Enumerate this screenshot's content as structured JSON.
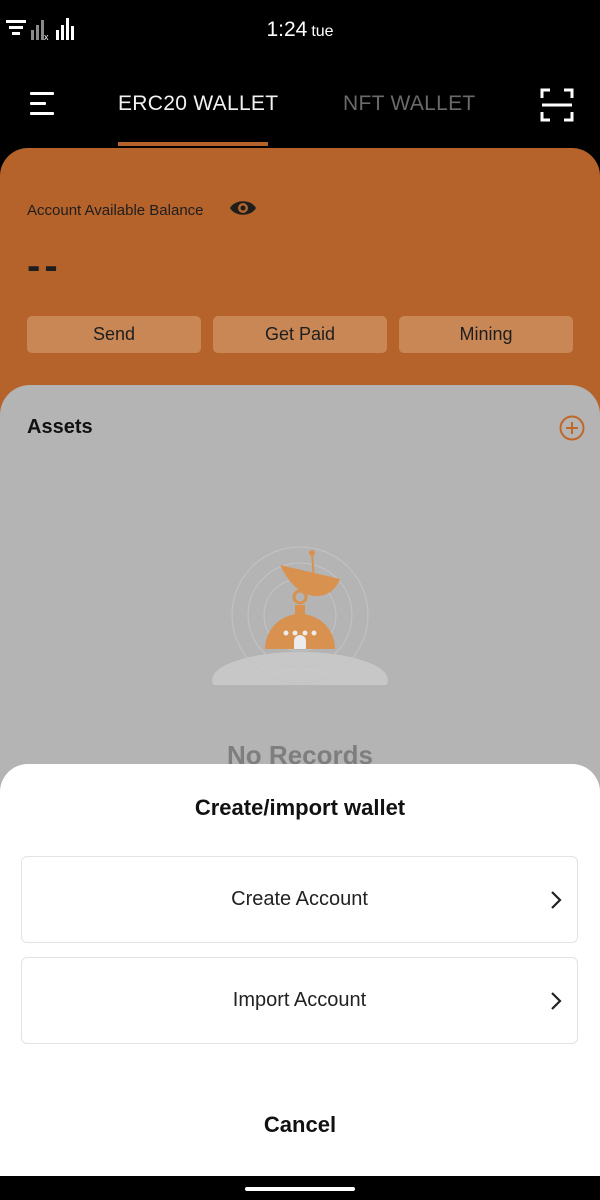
{
  "status_bar": {
    "time": "1:24",
    "day": "tue"
  },
  "nav": {
    "tabs": [
      {
        "label": "ERC20 WALLET",
        "active": true
      },
      {
        "label": "NFT WALLET",
        "active": false
      }
    ],
    "icons": [
      "menu-icon",
      "scan-icon"
    ]
  },
  "balance": {
    "label": "Account Available Balance",
    "value": "--",
    "actions": [
      "Send",
      "Get Paid",
      "Mining"
    ]
  },
  "assets": {
    "title": "Assets",
    "empty_text": "No Records"
  },
  "sheet": {
    "title": "Create/import wallet",
    "options": [
      "Create Account",
      "Import Account"
    ],
    "cancel_label": "Cancel"
  },
  "colors": {
    "accent": "#b5632a",
    "accent_light": "#c98756",
    "illustration": "#d9914f",
    "panel_gray": "#b4b4b4"
  }
}
